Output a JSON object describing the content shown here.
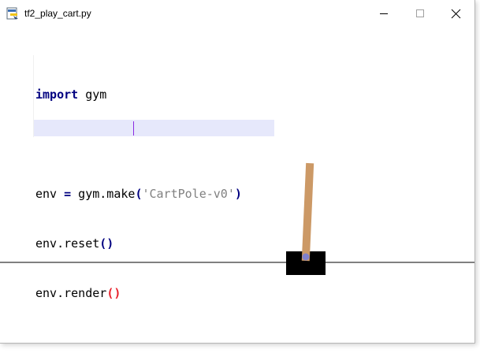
{
  "window": {
    "title": "tf2_play_cart.py",
    "icon": "python-file-icon",
    "controls": {
      "minimize_icon": "minimize-icon",
      "maximize_icon": "maximize-icon",
      "close_icon": "close-icon"
    }
  },
  "code": {
    "lines": [
      {
        "kw": "import",
        "rest": " gym"
      },
      {
        "text": ""
      },
      {
        "pre": "env ",
        "op": "=",
        "mid": " gym.make",
        "open": "(",
        "str": "'CartPole-v0'",
        "close": ")"
      },
      {
        "pre": "env.reset",
        "parens": "()"
      },
      {
        "pre": "env.render",
        "parens": "()"
      }
    ]
  },
  "colors": {
    "keyword": "#000080",
    "string": "#808080",
    "bracket_match": "#e8202a",
    "current_line": "#e6e8fb",
    "pole": "#cc9966",
    "cart": "#000000",
    "axle": "#8080cc",
    "track": "#000000"
  },
  "cartpole": {
    "pole_angle_deg": 2.5
  }
}
